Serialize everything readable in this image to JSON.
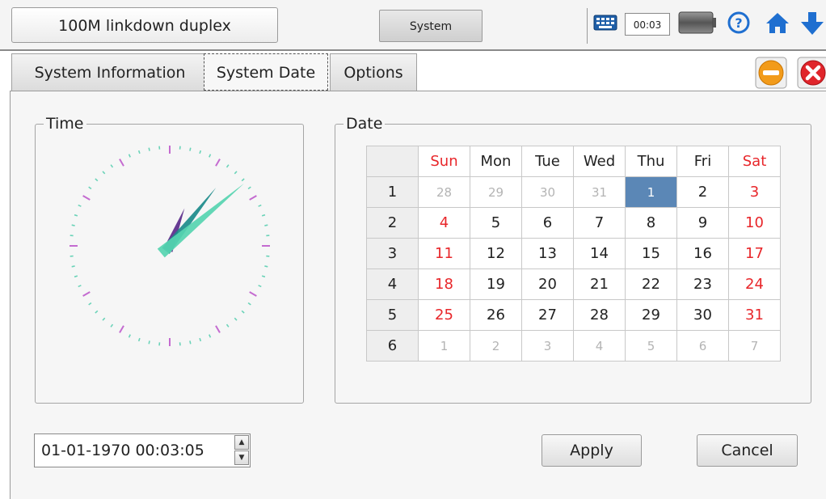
{
  "topbar": {
    "status_text": "100M linkdown duplex",
    "system_label": "System",
    "clock": "00:03",
    "icons": [
      "keyboard-icon",
      "battery-icon",
      "help-icon",
      "home-icon",
      "arrow-down-icon"
    ]
  },
  "tabs": [
    {
      "label": "System Information",
      "active": false
    },
    {
      "label": "System Date",
      "active": true
    },
    {
      "label": "Options",
      "active": false
    }
  ],
  "window_controls": [
    "minimize-icon",
    "close-icon"
  ],
  "time_group": {
    "title": "Time",
    "clock": {
      "hour": 0,
      "minute": 3,
      "second": 5
    }
  },
  "date_group": {
    "title": "Date",
    "calendar": {
      "headers": [
        "",
        "Sun",
        "Mon",
        "Tue",
        "Wed",
        "Thu",
        "Fri",
        "Sat"
      ],
      "weeks": [
        {
          "num": "1",
          "days": [
            "28",
            "29",
            "30",
            "31",
            "1",
            "2",
            "3"
          ]
        },
        {
          "num": "2",
          "days": [
            "4",
            "5",
            "6",
            "7",
            "8",
            "9",
            "10"
          ]
        },
        {
          "num": "3",
          "days": [
            "11",
            "12",
            "13",
            "14",
            "15",
            "16",
            "17"
          ]
        },
        {
          "num": "4",
          "days": [
            "18",
            "19",
            "20",
            "21",
            "22",
            "23",
            "24"
          ]
        },
        {
          "num": "5",
          "days": [
            "25",
            "26",
            "27",
            "28",
            "29",
            "30",
            "31"
          ]
        },
        {
          "num": "6",
          "days": [
            "1",
            "2",
            "3",
            "4",
            "5",
            "6",
            "7"
          ]
        }
      ],
      "selected": "1"
    }
  },
  "datetime_input": {
    "value": "01-01-1970  00:03:05"
  },
  "buttons": {
    "apply": "Apply",
    "cancel": "Cancel"
  },
  "colors": {
    "weekend": "#e8262a",
    "selected": "#5b87b6",
    "tick_major": "#c46bd0",
    "tick_minor": "#6ad3b8"
  }
}
